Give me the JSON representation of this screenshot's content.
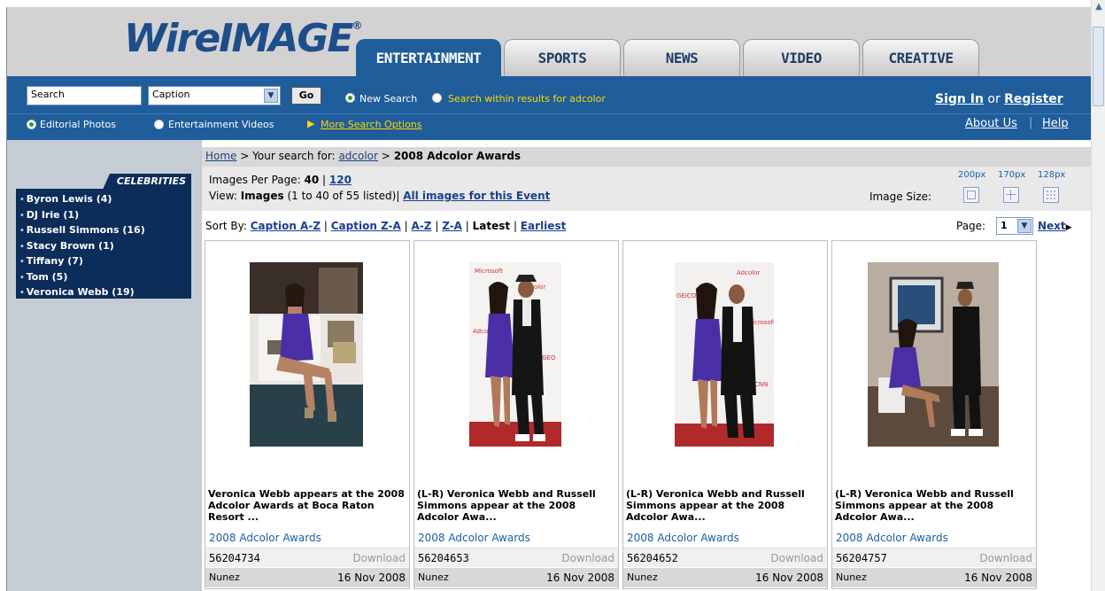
{
  "brand": {
    "logo_main": "WireIMAGE",
    "logo_sup": "®"
  },
  "tabs": [
    {
      "label": "ENTERTAINMENT",
      "active": true
    },
    {
      "label": "SPORTS"
    },
    {
      "label": "NEWS"
    },
    {
      "label": "VIDEO"
    },
    {
      "label": "CREATIVE"
    }
  ],
  "search": {
    "input_value": "Search",
    "field_select": "Caption",
    "go_label": "Go",
    "new_search": "New Search",
    "within_results": "Search within results for adcolor",
    "editorial_photos": "Editorial Photos",
    "entertainment_videos": "Entertainment Videos",
    "more_options": "More Search Options"
  },
  "account": {
    "sign_in": "Sign In",
    "or": "or",
    "register": "Register",
    "about": "About Us",
    "help": "Help"
  },
  "sidebar": {
    "header": "CELEBRITIES",
    "items": [
      "Byron Lewis (4)",
      "DJ Irie (1)",
      "Russell Simmons (16)",
      "Stacy Brown (1)",
      "Tiffany (7)",
      "Tom (5)",
      "Veronica Webb (19)"
    ]
  },
  "breadcrumb": {
    "home": "Home",
    "sep1": ">",
    "your_search": "Your search for:",
    "query": "adcolor",
    "sep2": ">",
    "current": "2008 Adcolor Awards"
  },
  "results": {
    "per_page_label": "Images Per Page:",
    "per_page_40": "40",
    "per_page_sep": "|",
    "per_page_120": "120",
    "view_label": "View:",
    "view_type": "Images",
    "range": "(1 to 40 of 55 listed)|",
    "all_images": "All images for this Event",
    "image_size_label": "Image Size:",
    "sizes": [
      "200px",
      "170px",
      "128px"
    ]
  },
  "sort": {
    "label": "Sort By:",
    "options": [
      "Caption A-Z",
      "Caption Z-A",
      "A-Z",
      "Z-A",
      "Latest",
      "Earliest"
    ],
    "sep": "|"
  },
  "pager": {
    "label": "Page:",
    "value": "1",
    "next": "Next"
  },
  "cards": [
    {
      "caption": "Veronica Webb appears at the 2008 Adcolor Awards at Boca Raton Resort ...",
      "event": "2008 Adcolor Awards",
      "id": "56204734",
      "download": "Download",
      "photographer": "Nunez",
      "date": "16 Nov 2008"
    },
    {
      "caption": "(L-R) Veronica Webb and Russell Simmons appear at the 2008 Adcolor Awa...",
      "event": "2008 Adcolor Awards",
      "id": "56204653",
      "download": "Download",
      "photographer": "Nunez",
      "date": "16 Nov 2008"
    },
    {
      "caption": "(L-R) Veronica Webb and Russell Simmons appear at the 2008 Adcolor Awa...",
      "event": "2008 Adcolor Awards",
      "id": "56204652",
      "download": "Download",
      "photographer": "Nunez",
      "date": "16 Nov 2008"
    },
    {
      "caption": "(L-R) Veronica Webb and Russell Simmons appear at the 2008 Adcolor Awa...",
      "event": "2008 Adcolor Awards",
      "id": "56204757",
      "download": "Download",
      "photographer": "Nunez",
      "date": "16 Nov 2008"
    }
  ],
  "colors": {
    "brand_blue": "#1f5d9b",
    "navy": "#0c2c5a",
    "link": "#1a3f8f",
    "yellow_text": "#ffd800"
  }
}
